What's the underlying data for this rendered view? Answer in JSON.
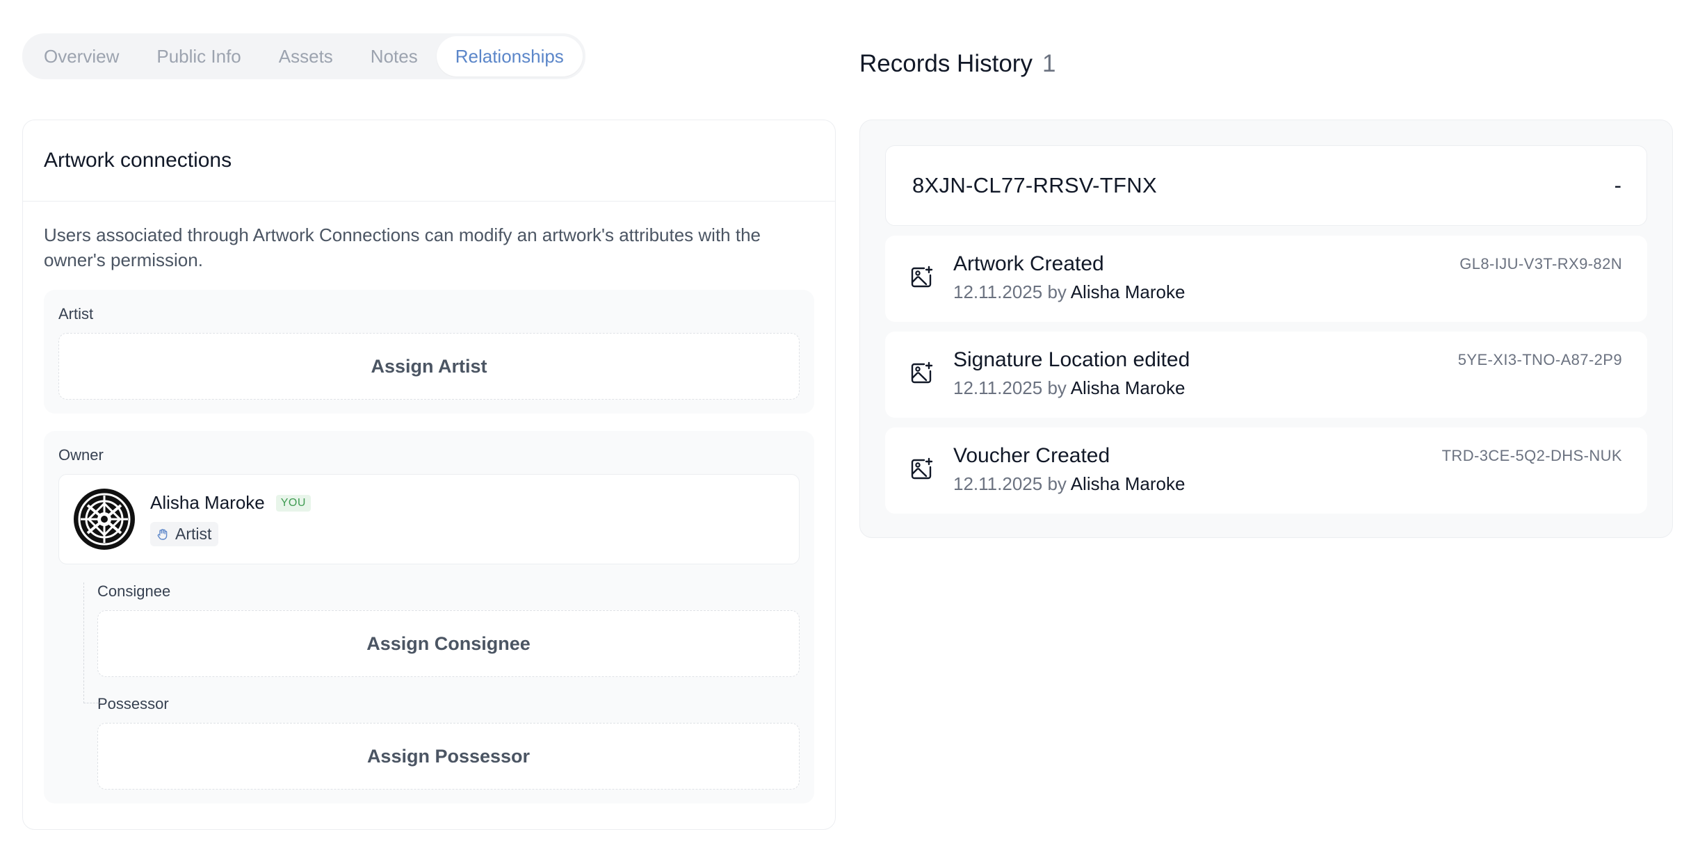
{
  "tabs": [
    {
      "label": "Overview",
      "active": false
    },
    {
      "label": "Public Info",
      "active": false
    },
    {
      "label": "Assets",
      "active": false
    },
    {
      "label": "Notes",
      "active": false
    },
    {
      "label": "Relationships",
      "active": true
    }
  ],
  "connections": {
    "title": "Artwork connections",
    "description": "Users associated through Artwork Connections can modify an artwork's attributes with the owner's permission.",
    "artist": {
      "label": "Artist",
      "assign_label": "Assign Artist"
    },
    "owner": {
      "label": "Owner",
      "name": "Alisha Maroke",
      "badge": "YOU",
      "role": "Artist"
    },
    "consignee": {
      "label": "Consignee",
      "assign_label": "Assign Consignee"
    },
    "possessor": {
      "label": "Possessor",
      "assign_label": "Assign Possessor"
    }
  },
  "history": {
    "title": "Records History",
    "count": "1",
    "record_id": "8XJN-CL77-RRSV-TFNX",
    "record_value": "-",
    "events": [
      {
        "title": "Artwork Created",
        "date": "12.11.2025",
        "by": "by",
        "user": "Alisha Maroke",
        "code": "GL8-IJU-V3T-RX9-82N",
        "icon": "image-plus-icon"
      },
      {
        "title": "Signature Location edited",
        "date": "12.11.2025",
        "by": "by",
        "user": "Alisha Maroke",
        "code": "5YE-XI3-TNO-A87-2P9",
        "icon": "image-plus-icon"
      },
      {
        "title": "Voucher Created",
        "date": "12.11.2025",
        "by": "by",
        "user": "Alisha Maroke",
        "code": "TRD-3CE-5Q2-DHS-NUK",
        "icon": "image-plus-icon"
      }
    ]
  },
  "colors": {
    "accent": "#5b86c9",
    "badge_bg": "#e8f5ea",
    "badge_text": "#3f9c52"
  }
}
